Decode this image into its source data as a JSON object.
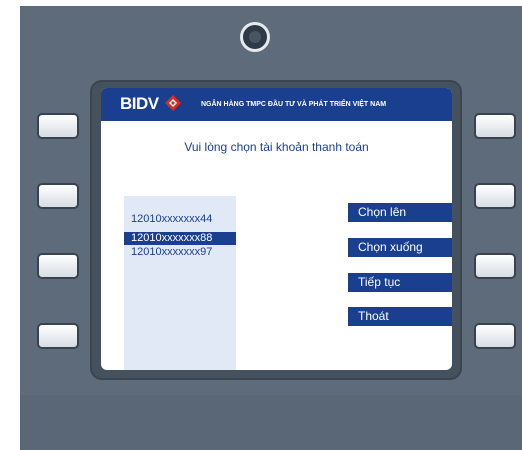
{
  "bank": {
    "logo_text": "BIDV",
    "name": "NGÂN HÀNG TMPC ĐẦU TƯ VÀ PHÁT TRIỂN VIỆT NAM"
  },
  "prompt": "Vui lòng chọn tài khoản thanh toán",
  "accounts": [
    {
      "number": "12010xxxxxxx44",
      "selected": false
    },
    {
      "number": "12010xxxxxxx88",
      "selected": true
    },
    {
      "number": "12010xxxxxxx97",
      "selected": false
    }
  ],
  "menu": {
    "up": "Chọn lên",
    "down": "Chọn xuống",
    "continue": "Tiếp tục",
    "exit": "Thoát"
  },
  "colors": {
    "brand": "#1b3f8f",
    "logo_accent": "#d62d20",
    "list_background": "#e2e9f6",
    "atm_body": "#5e6b7a"
  },
  "icons": {
    "camera": "camera-icon",
    "logo_mark": "bidv-diamond-logo"
  }
}
